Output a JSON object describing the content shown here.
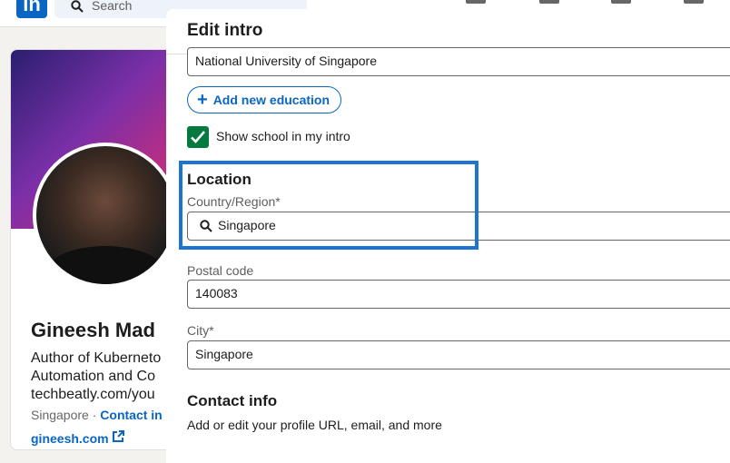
{
  "nav": {
    "logo_text": "in",
    "search_placeholder": "Search",
    "icons": [
      "home-icon",
      "network-icon",
      "jobs-icon",
      "messaging-icon"
    ]
  },
  "profile": {
    "name": "Gineesh Mad",
    "headline": "Author of Kuberneto Automation and Co techbeatly.com/you",
    "location": "Singapore",
    "separator": "·",
    "contact_info": "Contact in",
    "website": "gineesh.com"
  },
  "modal": {
    "title": "Edit intro",
    "school_value": "National University of Singapore",
    "add_education_label": "Add new education",
    "show_school_label": "Show school in my intro",
    "show_school_checked": true,
    "location": {
      "title": "Location",
      "country_label": "Country/Region*",
      "country_value": "Singapore",
      "postal_label": "Postal code",
      "postal_value": "140083",
      "city_label": "City*",
      "city_value": "Singapore"
    },
    "contact": {
      "title": "Contact info",
      "subtitle": "Add or edit your profile URL, email, and more"
    }
  },
  "colors": {
    "brand": "#0a66c2",
    "checkbox": "#067a3e",
    "highlight": "#1d74d2"
  }
}
